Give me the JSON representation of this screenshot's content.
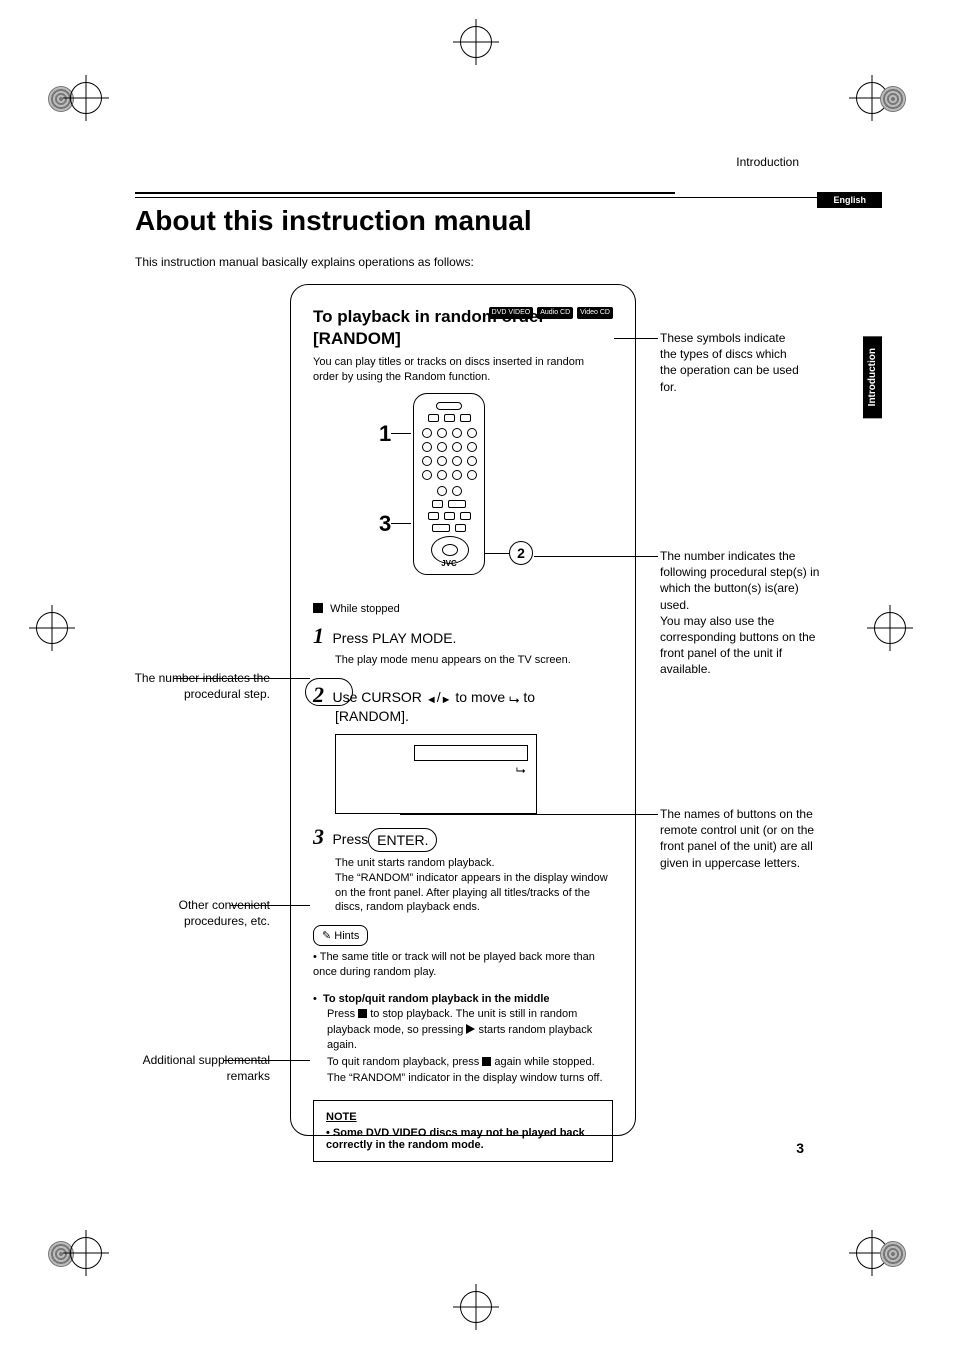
{
  "header": {
    "section": "Introduction",
    "language": "English",
    "side_tab": "Introduction",
    "page_number": "3"
  },
  "title": "About this instruction manual",
  "intro": "This instruction manual basically explains operations as follows:",
  "sample": {
    "heading_line1": "To playback  in random order",
    "heading_line2": "[RANDOM]",
    "disc_badges": [
      "DVD VIDEO",
      "Audio CD",
      "Video CD"
    ],
    "description": "You can play titles or tracks on discs inserted in random order by using the Random function.",
    "remote_brand": "JVC",
    "remote_step_labels": {
      "one": "1",
      "three": "3",
      "bubble_two": "2"
    },
    "precond": "While stopped",
    "step1": {
      "num": "1",
      "line": "Press PLAY MODE.",
      "body": "The play mode menu appears on the TV screen."
    },
    "step2": {
      "num": "2",
      "line_a": "Use CURSOR ",
      "line_b": " to move ",
      "line_c": " to",
      "line2": "[RANDOM]."
    },
    "step3": {
      "num": "3",
      "line_prefix": "Press ",
      "button": "ENTER.",
      "body": "The unit starts random playback.\nThe “RANDOM” indicator appears in the display window on the front panel. After playing all titles/tracks of the discs, random playback ends."
    },
    "hints_label": "Hints",
    "hints_bullet": "The same title or track will not be played back more than once during random play.",
    "stopquit": {
      "title": "To stop/quit random playback in the middle",
      "line1a": "Press ",
      "line1b": " to stop playback. The unit is still in random playback mode, so pressing ",
      "line1c": " starts random playback again.",
      "line2a": "To quit random playback, press ",
      "line2b": " again while stopped. The “RANDOM” indicator in the display window turns off."
    },
    "note_title": "NOTE",
    "note_body": "Some DVD VIDEO discs may not be played back correctly in the random mode."
  },
  "annotations": {
    "symbols": "These symbols indicate the types of discs which the operation can be used for.",
    "bubble_number": "The number indicates the following procedural step(s) in which the button(s) is(are) used.\nYou may also use the corresponding buttons on the front panel of the unit if available.",
    "button_names": "The names of buttons on the remote control unit (or on the front panel of the unit) are all given in uppercase letters.",
    "step_number": "The number indicates the procedural step.",
    "hints": "Other convenient procedures, etc.",
    "note": "Additional supplemental remarks"
  }
}
